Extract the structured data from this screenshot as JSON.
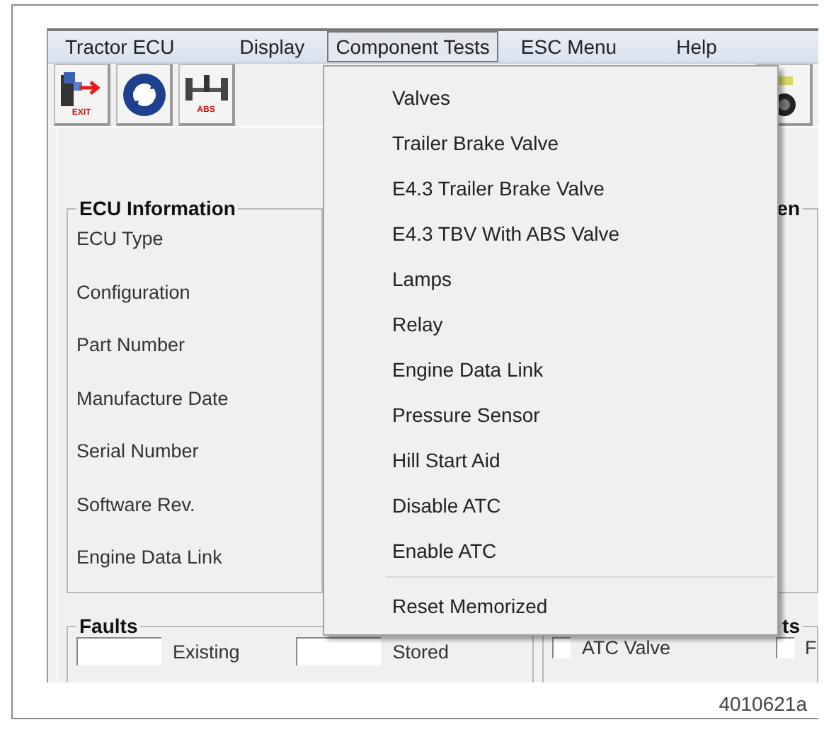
{
  "menu_bar": [
    {
      "label": "Tractor ECU",
      "selected": false
    },
    {
      "label": "Display",
      "selected": false
    },
    {
      "label": "Component Tests",
      "selected": true
    },
    {
      "label": "ESC Menu",
      "selected": false
    },
    {
      "label": "Help",
      "selected": false
    }
  ],
  "toolbar": [
    {
      "kind": "exit",
      "label": "EXIT"
    },
    {
      "kind": "refresh"
    },
    {
      "kind": "abs",
      "label": "ABS"
    },
    {
      "kind": "gauge"
    }
  ],
  "dropdown": [
    {
      "kind": "item",
      "label": "Valves"
    },
    {
      "kind": "item",
      "label": "Trailer Brake Valve"
    },
    {
      "kind": "item",
      "label": "E4.3 Trailer Brake Valve"
    },
    {
      "kind": "item",
      "label": "E4.3 TBV With ABS Valve"
    },
    {
      "kind": "item",
      "label": "Lamps"
    },
    {
      "kind": "item",
      "label": "Relay"
    },
    {
      "kind": "item",
      "label": "Engine Data Link"
    },
    {
      "kind": "item",
      "label": "Pressure Sensor"
    },
    {
      "kind": "item",
      "label": "Hill Start Aid"
    },
    {
      "kind": "item",
      "label": "Disable ATC"
    },
    {
      "kind": "item",
      "label": "Enable ATC"
    },
    {
      "kind": "separator"
    },
    {
      "kind": "item",
      "label": "Reset Memorized"
    }
  ],
  "ecu_information": {
    "title": "ECU Information",
    "fields": [
      "ECU Type",
      "Configuration",
      "Part Number",
      "Manufacture Date",
      "Serial Number",
      "Software Rev.",
      "Engine Data Link"
    ]
  },
  "right_group": {
    "title": "en"
  },
  "faults": {
    "title": "Faults",
    "indicators": [
      {
        "kind": "box",
        "label": "Existing",
        "checked": false
      },
      {
        "kind": "box",
        "label": "Stored",
        "checked": false
      }
    ]
  },
  "right_bottom_group": {
    "title": "ts",
    "checks": [
      {
        "kind": "checkbox",
        "label": "ATC Valve",
        "checked": false
      },
      {
        "kind": "checkbox",
        "label": "F",
        "checked": false
      }
    ]
  },
  "caption": "4010621a"
}
